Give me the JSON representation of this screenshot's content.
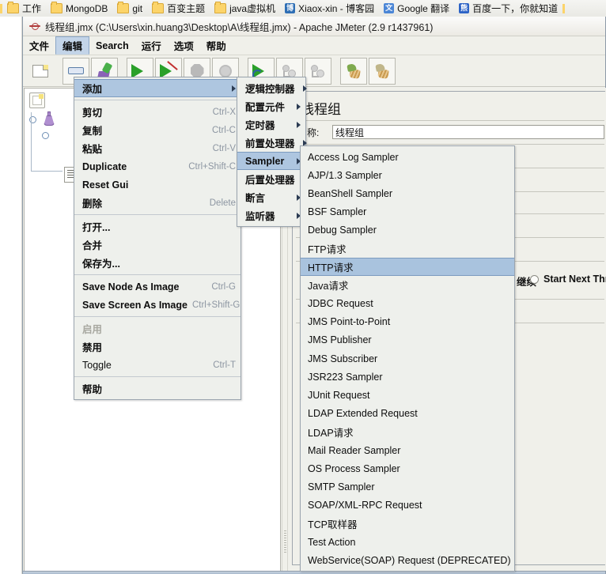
{
  "browser_bookmarks": [
    {
      "icon": "folder-icon",
      "label": "工作"
    },
    {
      "icon": "folder-icon",
      "label": "MongoDB"
    },
    {
      "icon": "folder-icon",
      "label": "git"
    },
    {
      "icon": "folder-icon",
      "label": "百变主题"
    },
    {
      "icon": "folder-icon",
      "label": "java虚拟机"
    },
    {
      "icon": "cnblogs-icon",
      "label": "Xiaox-xin - 博客园"
    },
    {
      "icon": "google-translate-icon",
      "label": "Google 翻译"
    },
    {
      "icon": "baidu-icon",
      "label": "百度一下，你就知道"
    }
  ],
  "window": {
    "title": "线程组.jmx (C:\\Users\\xin.huang3\\Desktop\\A\\线程组.jmx) - Apache JMeter (2.9 r1437961)",
    "logo_icon": "jmeter-logo-icon"
  },
  "menubar": [
    {
      "label": "文件",
      "open": false
    },
    {
      "label": "编辑",
      "open": true
    },
    {
      "label": "Search",
      "open": false
    },
    {
      "label": "运行",
      "open": false
    },
    {
      "label": "选项",
      "open": false
    },
    {
      "label": "帮助",
      "open": false
    }
  ],
  "toolbar": [
    {
      "name": "new-button",
      "icon": "new-document-icon",
      "framed": false,
      "enabled": true
    },
    {
      "name": "templates-button",
      "icon": "minus-icon",
      "framed": true,
      "enabled": true
    },
    {
      "name": "open-button",
      "icon": "templates-icon",
      "framed": true,
      "enabled": true
    },
    {
      "name": "start-button",
      "icon": "play-icon",
      "framed": true,
      "enabled": true
    },
    {
      "name": "start-no-pauses-button",
      "icon": "play-no-pauses-icon",
      "framed": true,
      "enabled": true
    },
    {
      "name": "stop-button",
      "icon": "stop-octagon-icon",
      "framed": true,
      "enabled": false
    },
    {
      "name": "shutdown-button",
      "icon": "shutdown-gear-icon",
      "framed": true,
      "enabled": false
    },
    {
      "name": "remote-start-all-button",
      "icon": "remote-play-icon",
      "framed": true,
      "enabled": true
    },
    {
      "name": "clear-button",
      "icon": "clear-icon",
      "framed": true,
      "enabled": false
    },
    {
      "name": "clear-all-button",
      "icon": "clear-all-icon",
      "framed": true,
      "enabled": false
    },
    {
      "name": "toggle-log-button",
      "icon": "broom-green-icon",
      "framed": true,
      "enabled": true
    },
    {
      "name": "function-helper-button",
      "icon": "broom-tan-icon",
      "framed": true,
      "enabled": true
    }
  ],
  "tree": {
    "nodes": [
      {
        "label": "",
        "icon": "test-plan-icon",
        "depth": 0,
        "selected": true
      },
      {
        "label": "",
        "icon": "thread-group-icon",
        "depth": 1,
        "selected": false
      },
      {
        "label": "",
        "icon": "listener-icon",
        "depth": 2,
        "selected": false
      }
    ]
  },
  "edit_menu": {
    "items": [
      {
        "label": "添加",
        "accel": "",
        "submenu": true,
        "selected": true,
        "bold": true,
        "enabled": true
      },
      {
        "separator": true
      },
      {
        "label": "剪切",
        "accel": "Ctrl-X",
        "submenu": false,
        "bold": true,
        "enabled": true
      },
      {
        "label": "复制",
        "accel": "Ctrl-C",
        "submenu": false,
        "bold": true,
        "enabled": true
      },
      {
        "label": "粘贴",
        "accel": "Ctrl-V",
        "submenu": false,
        "bold": true,
        "enabled": true
      },
      {
        "label": "Duplicate",
        "accel": "Ctrl+Shift-C",
        "submenu": false,
        "bold": true,
        "enabled": true
      },
      {
        "label": "Reset Gui",
        "accel": "",
        "submenu": false,
        "bold": true,
        "enabled": true
      },
      {
        "label": "删除",
        "accel": "Delete",
        "submenu": false,
        "bold": true,
        "enabled": true
      },
      {
        "separator": true
      },
      {
        "label": "打开...",
        "accel": "",
        "submenu": false,
        "bold": true,
        "enabled": true
      },
      {
        "label": "合并",
        "accel": "",
        "submenu": false,
        "bold": true,
        "enabled": true
      },
      {
        "label": "保存为...",
        "accel": "",
        "submenu": false,
        "bold": true,
        "enabled": true
      },
      {
        "separator": true
      },
      {
        "label": "Save Node As Image",
        "accel": "Ctrl-G",
        "submenu": false,
        "bold": true,
        "enabled": true
      },
      {
        "label": "Save Screen As Image",
        "accel": "Ctrl+Shift-G",
        "submenu": false,
        "bold": true,
        "enabled": true
      },
      {
        "separator": true
      },
      {
        "label": "启用",
        "accel": "",
        "submenu": false,
        "bold": true,
        "enabled": false
      },
      {
        "label": "禁用",
        "accel": "",
        "submenu": false,
        "bold": true,
        "enabled": true
      },
      {
        "label": "Toggle",
        "accel": "Ctrl-T",
        "submenu": false,
        "bold": false,
        "enabled": true
      },
      {
        "separator": true
      },
      {
        "label": "帮助",
        "accel": "",
        "submenu": false,
        "bold": true,
        "enabled": true
      }
    ]
  },
  "add_submenu": {
    "items": [
      {
        "label": "逻辑控制器",
        "submenu": true,
        "selected": false
      },
      {
        "label": "配置元件",
        "submenu": true,
        "selected": false
      },
      {
        "label": "定时器",
        "submenu": true,
        "selected": false
      },
      {
        "label": "前置处理器",
        "submenu": true,
        "selected": false
      },
      {
        "label": "Sampler",
        "submenu": true,
        "selected": true
      },
      {
        "label": "后置处理器",
        "submenu": true,
        "selected": false
      },
      {
        "label": "断言",
        "submenu": true,
        "selected": false
      },
      {
        "label": "监听器",
        "submenu": true,
        "selected": false
      }
    ]
  },
  "sampler_menu": {
    "items": [
      {
        "label": "Access Log Sampler",
        "selected": false
      },
      {
        "label": "AJP/1.3 Sampler",
        "selected": false
      },
      {
        "label": "BeanShell Sampler",
        "selected": false
      },
      {
        "label": "BSF Sampler",
        "selected": false
      },
      {
        "label": "Debug Sampler",
        "selected": false
      },
      {
        "label": "FTP请求",
        "selected": false
      },
      {
        "label": "HTTP请求",
        "selected": true
      },
      {
        "label": "Java请求",
        "selected": false
      },
      {
        "label": "JDBC Request",
        "selected": false
      },
      {
        "label": "JMS Point-to-Point",
        "selected": false
      },
      {
        "label": "JMS Publisher",
        "selected": false
      },
      {
        "label": "JMS Subscriber",
        "selected": false
      },
      {
        "label": "JSR223 Sampler",
        "selected": false
      },
      {
        "label": "JUnit Request",
        "selected": false
      },
      {
        "label": "LDAP Extended Request",
        "selected": false
      },
      {
        "label": "LDAP请求",
        "selected": false
      },
      {
        "label": "Mail Reader Sampler",
        "selected": false
      },
      {
        "label": "OS Process Sampler",
        "selected": false
      },
      {
        "label": "SMTP Sampler",
        "selected": false
      },
      {
        "label": "SOAP/XML-RPC Request",
        "selected": false
      },
      {
        "label": "TCP取样器",
        "selected": false
      },
      {
        "label": "Test Action",
        "selected": false
      },
      {
        "label": "WebService(SOAP) Request (DEPRECATED)",
        "selected": false
      }
    ]
  },
  "thread_group_panel": {
    "title": "线程组",
    "name_label": "名称:",
    "name_value": "线程组",
    "continue_label": "继续",
    "start_next_thread_label": "Start Next Thread L"
  },
  "colors": {
    "menu_highlight": "#aec6e0",
    "menu_bg": "#eef0ec",
    "window_bg": "#f0f0ea",
    "accent_green": "#2aa02a",
    "folder_yellow": "#fcd46a"
  }
}
